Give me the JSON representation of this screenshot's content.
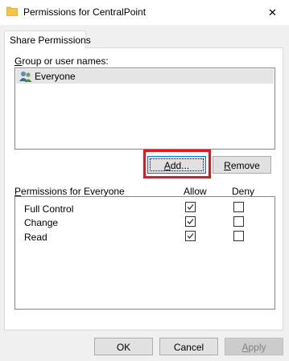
{
  "window": {
    "title": "Permissions for CentralPoint",
    "close_glyph": "✕"
  },
  "tab": {
    "label": "Share Permissions"
  },
  "groups": {
    "label": "Group or user names:",
    "items": [
      {
        "name": "Everyone",
        "icon": "users-icon",
        "selected": true
      }
    ]
  },
  "buttons": {
    "add": "Add...",
    "remove": "Remove",
    "ok": "OK",
    "cancel": "Cancel",
    "apply": "Apply"
  },
  "permissions": {
    "label": "Permissions for Everyone",
    "allow_header": "Allow",
    "deny_header": "Deny",
    "rows": [
      {
        "name": "Full Control",
        "allow": true,
        "deny": false
      },
      {
        "name": "Change",
        "allow": true,
        "deny": false
      },
      {
        "name": "Read",
        "allow": true,
        "deny": false
      }
    ]
  },
  "colors": {
    "highlight": "#e8141f",
    "selection": "#e5e5e5",
    "focus_border": "#0078d7"
  }
}
